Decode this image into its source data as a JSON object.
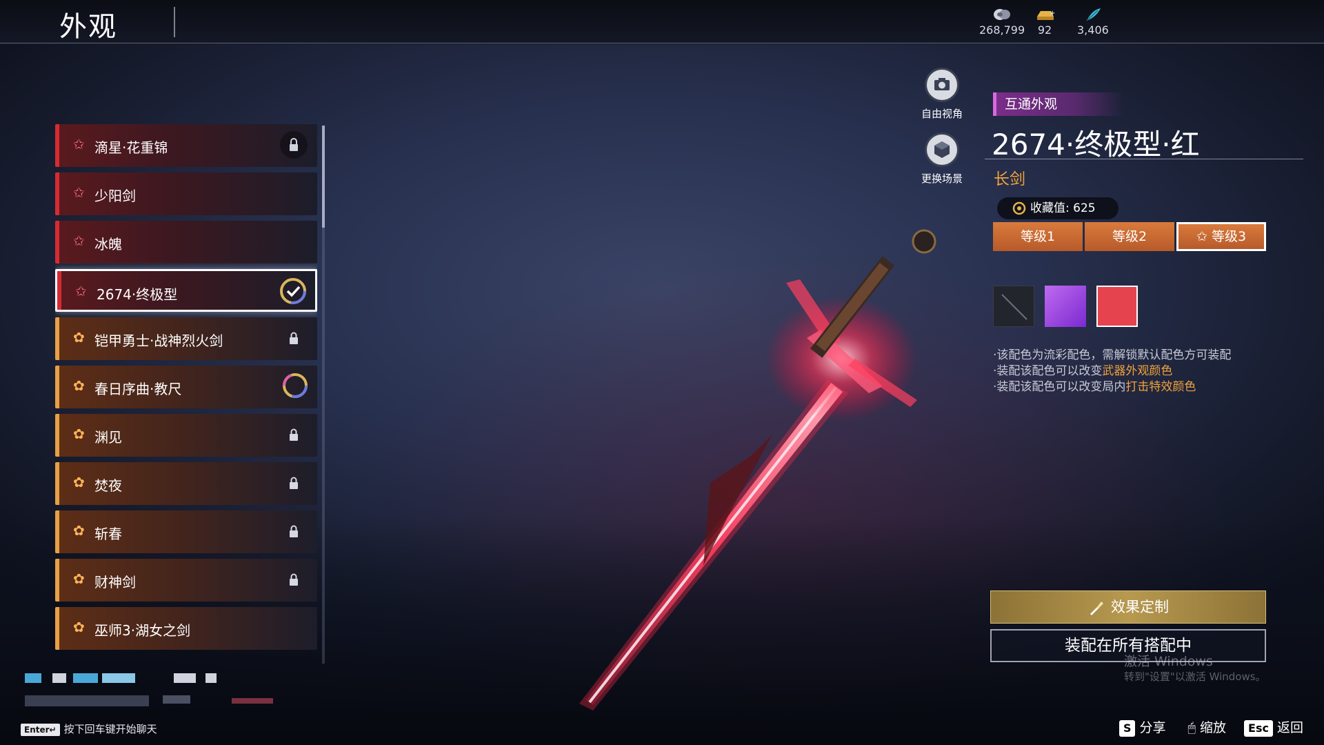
{
  "header": {
    "title": "外观",
    "currencies": [
      {
        "icon": "silver-coin-icon",
        "value": "268,799"
      },
      {
        "icon": "gold-ingot-icon",
        "value": "92"
      },
      {
        "icon": "feather-icon",
        "value": "3,406"
      }
    ]
  },
  "list": {
    "items": [
      {
        "label": "滴星·花重锦",
        "rarity": "red",
        "status": "locked-badge"
      },
      {
        "label": "少阳剑",
        "rarity": "red",
        "status": "none"
      },
      {
        "label": "冰魄",
        "rarity": "red",
        "status": "none"
      },
      {
        "label": "2674·终极型",
        "rarity": "red",
        "status": "equipped",
        "selected": true
      },
      {
        "label": "铠甲勇士·战神烈火剑",
        "rarity": "gold",
        "status": "locked"
      },
      {
        "label": "春日序曲·教尺",
        "rarity": "gold",
        "status": "ring"
      },
      {
        "label": "渊见",
        "rarity": "gold",
        "status": "locked"
      },
      {
        "label": "焚夜",
        "rarity": "gold",
        "status": "locked"
      },
      {
        "label": "斩春",
        "rarity": "gold",
        "status": "locked"
      },
      {
        "label": "财神剑",
        "rarity": "gold",
        "status": "locked"
      },
      {
        "label": "巫师3·湖女之剑",
        "rarity": "gold",
        "status": "none"
      }
    ]
  },
  "side_buttons": {
    "free_view": "自由视角",
    "change_scene": "更换场景"
  },
  "detail": {
    "tag": "互通外观",
    "name": "2674·终极型·红",
    "weapon_type": "长剑",
    "collection_label": "收藏值: 625",
    "levels": [
      "等级1",
      "等级2",
      "等级3"
    ],
    "active_level": "等级3",
    "swatches": [
      {
        "name": "default",
        "color": "#2a2c34"
      },
      {
        "name": "purple",
        "color": "#9a3fe0"
      },
      {
        "name": "red",
        "color": "#e0404a"
      }
    ],
    "desc1": "·该配色为流彩配色，需解锁默认配色方可装配",
    "desc2_prefix": "·装配该配色可以改变",
    "desc2_highlight": "武器外观颜色",
    "desc3_prefix": "·装配该配色可以改变局内",
    "desc3_highlight": "打击特效颜色"
  },
  "actions": {
    "effect_customize": "效果定制",
    "equip_all": "装配在所有搭配中"
  },
  "footer": {
    "chat_key": "Enter↵",
    "chat_hint": "按下回车键开始聊天",
    "share_key": "S",
    "share": "分享",
    "zoom": "缩放",
    "back_key": "Esc",
    "back": "返回"
  },
  "watermark": {
    "line1": "激活 Windows",
    "line2": "转到\"设置\"以激活 Windows。"
  },
  "colors": {
    "accent_orange": "#f0a23c",
    "rarity_red": "#d52b35",
    "rarity_gold": "#e8a046"
  }
}
